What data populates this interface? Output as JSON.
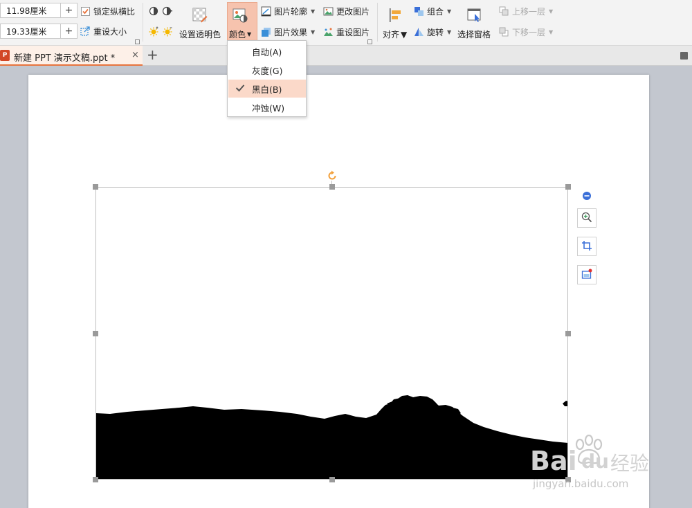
{
  "ribbon": {
    "size": {
      "height_value": "11.98厘米",
      "width_value": "19.33厘米",
      "plus": "+",
      "lock_ratio_label": "锁定纵横比",
      "reset_size_label": "重设大小"
    },
    "set_transparent_label": "设置透明色",
    "color_label": "颜色",
    "picture_outline_label": "图片轮廓",
    "picture_effects_label": "图片效果",
    "change_picture_label": "更改图片",
    "reset_picture_label": "重设图片",
    "align_label": "对齐",
    "group_label": "组合",
    "rotate_label": "旋转",
    "selection_pane_label": "选择窗格",
    "bring_forward_label": "上移一层",
    "send_backward_label": "下移一层"
  },
  "tabs": {
    "doc_title": "新建 PPT 演示文稿.ppt *",
    "close": "×",
    "add": "+",
    "file_icon_letter": "P"
  },
  "color_menu": {
    "items": [
      {
        "label": "自动(A)",
        "selected": false
      },
      {
        "label": "灰度(G)",
        "selected": false
      },
      {
        "label": "黑白(B)",
        "selected": true
      },
      {
        "label": "冲蚀(W)",
        "selected": false
      }
    ]
  },
  "watermark": {
    "brand": "Bai",
    "brand2": "du",
    "cn": "经验",
    "url": "jingyan.baidu.com"
  },
  "colors": {
    "accent": "#e8733c",
    "selected_bg": "#fbd9c9",
    "color_button_bg": "#f6c3ae",
    "canvas_bg": "#c3c7cf"
  }
}
